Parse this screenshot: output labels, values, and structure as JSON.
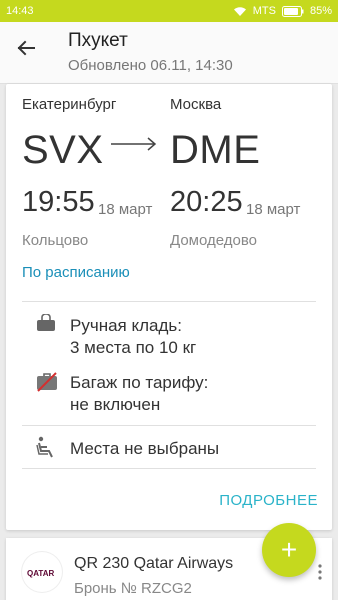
{
  "status_bar": {
    "time": "14:43",
    "carrier": "MTS",
    "battery": "85%"
  },
  "header": {
    "title": "Пхукет",
    "subtitle": "Обновлено 06.11, 14:30"
  },
  "flight": {
    "departure": {
      "city": "Екатеринбург",
      "code": "SVX",
      "time": "19:55",
      "date": "18 март",
      "airport": "Кольцово"
    },
    "arrival": {
      "city": "Москва",
      "code": "DME",
      "time": "20:25",
      "date": "18 март",
      "airport": "Домодедово"
    },
    "status_link": "По расписанию",
    "hand_luggage": {
      "title": "Ручная кладь:",
      "value": "3 места по 10 кг"
    },
    "baggage": {
      "title": "Багаж по тарифу:",
      "value": "не включен"
    },
    "seats": "Места не выбраны",
    "details_button": "ПОДРОБНЕЕ"
  },
  "next_flight": {
    "logo_text": "QATAR",
    "flight": "QR 230 Qatar Airways",
    "booking": "Бронь № RZCG2"
  },
  "fab": {
    "label": "+"
  },
  "colors": {
    "accent": "#c5d91e",
    "link": "#1a8fb8",
    "details": "#2ab3c9",
    "qatar": "#5c0632"
  },
  "icons": [
    "back-arrow-icon",
    "flight-arrow-icon",
    "hand-luggage-icon",
    "baggage-crossed-icon",
    "seat-icon",
    "more-vert-icon",
    "wifi-icon",
    "battery-icon",
    "plus-icon"
  ]
}
